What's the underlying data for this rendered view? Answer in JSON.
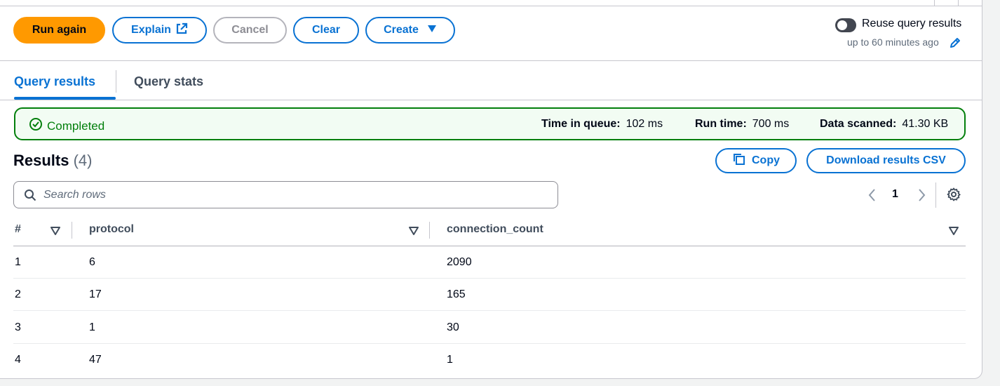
{
  "toolbar": {
    "run_again": "Run again",
    "explain": "Explain",
    "cancel": "Cancel",
    "clear": "Clear",
    "create": "Create"
  },
  "reuse": {
    "label": "Reuse query results",
    "sublabel": "up to 60 minutes ago",
    "enabled": false
  },
  "tabs": [
    {
      "label": "Query results",
      "active": true
    },
    {
      "label": "Query stats",
      "active": false
    }
  ],
  "status": {
    "state": "Completed",
    "time_in_queue_label": "Time in queue:",
    "time_in_queue_value": "102 ms",
    "run_time_label": "Run time:",
    "run_time_value": "700 ms",
    "data_scanned_label": "Data scanned:",
    "data_scanned_value": "41.30 KB"
  },
  "results": {
    "title": "Results",
    "count": "(4)",
    "copy_label": "Copy",
    "download_label": "Download results CSV",
    "search_placeholder": "Search rows",
    "current_page": "1",
    "columns": [
      "#",
      "protocol",
      "connection_count"
    ],
    "rows": [
      [
        "1",
        "6",
        "2090"
      ],
      [
        "2",
        "17",
        "165"
      ],
      [
        "3",
        "1",
        "30"
      ],
      [
        "4",
        "47",
        "1"
      ]
    ]
  },
  "colors": {
    "primary": "#ff9900",
    "link": "#0972d3",
    "success": "#037f0c",
    "success_bg": "#f2fcf3"
  }
}
